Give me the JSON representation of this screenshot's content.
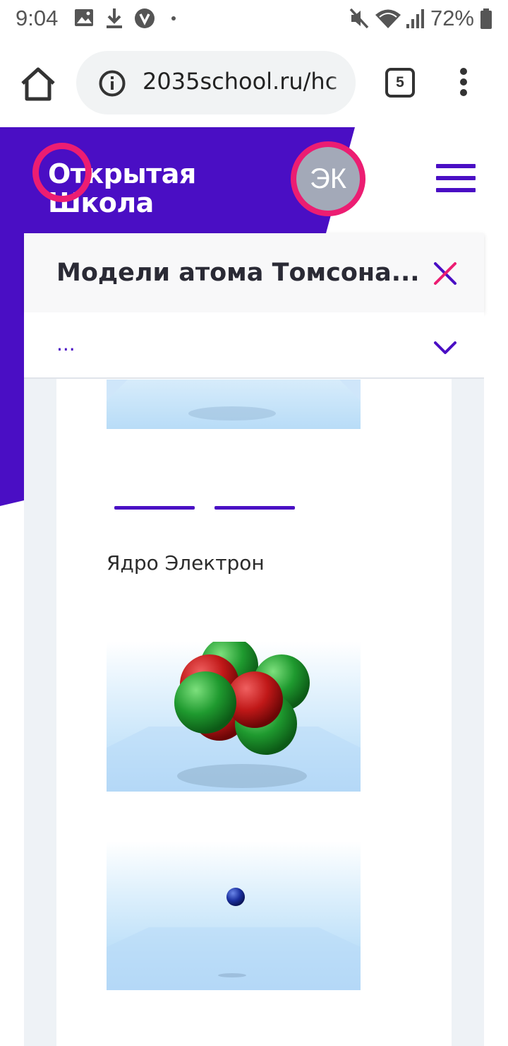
{
  "status_bar": {
    "time": "9:04",
    "battery": "72%",
    "icons": [
      "image-icon",
      "download-icon",
      "v-app-icon",
      "dot-icon",
      "mute-icon",
      "wifi-icon",
      "signal-icon",
      "battery-icon"
    ]
  },
  "browser": {
    "url": "2035school.ru/hc",
    "tab_count": "5",
    "icons": [
      "home-icon",
      "info-icon",
      "tabs-icon",
      "more-vert-icon"
    ]
  },
  "site": {
    "logo_line1": "Открытая",
    "logo_line2": "Школа",
    "avatar_initials": "ЭК",
    "brand_purple": "#4a0ec4",
    "brand_pink": "#ec1d72"
  },
  "lesson": {
    "title": "Модели атома Томсона...",
    "section": "..."
  },
  "content": {
    "caption": "Ядро Электрон",
    "images": [
      "atom-image-partial",
      "nucleus-image",
      "electron-image"
    ]
  }
}
